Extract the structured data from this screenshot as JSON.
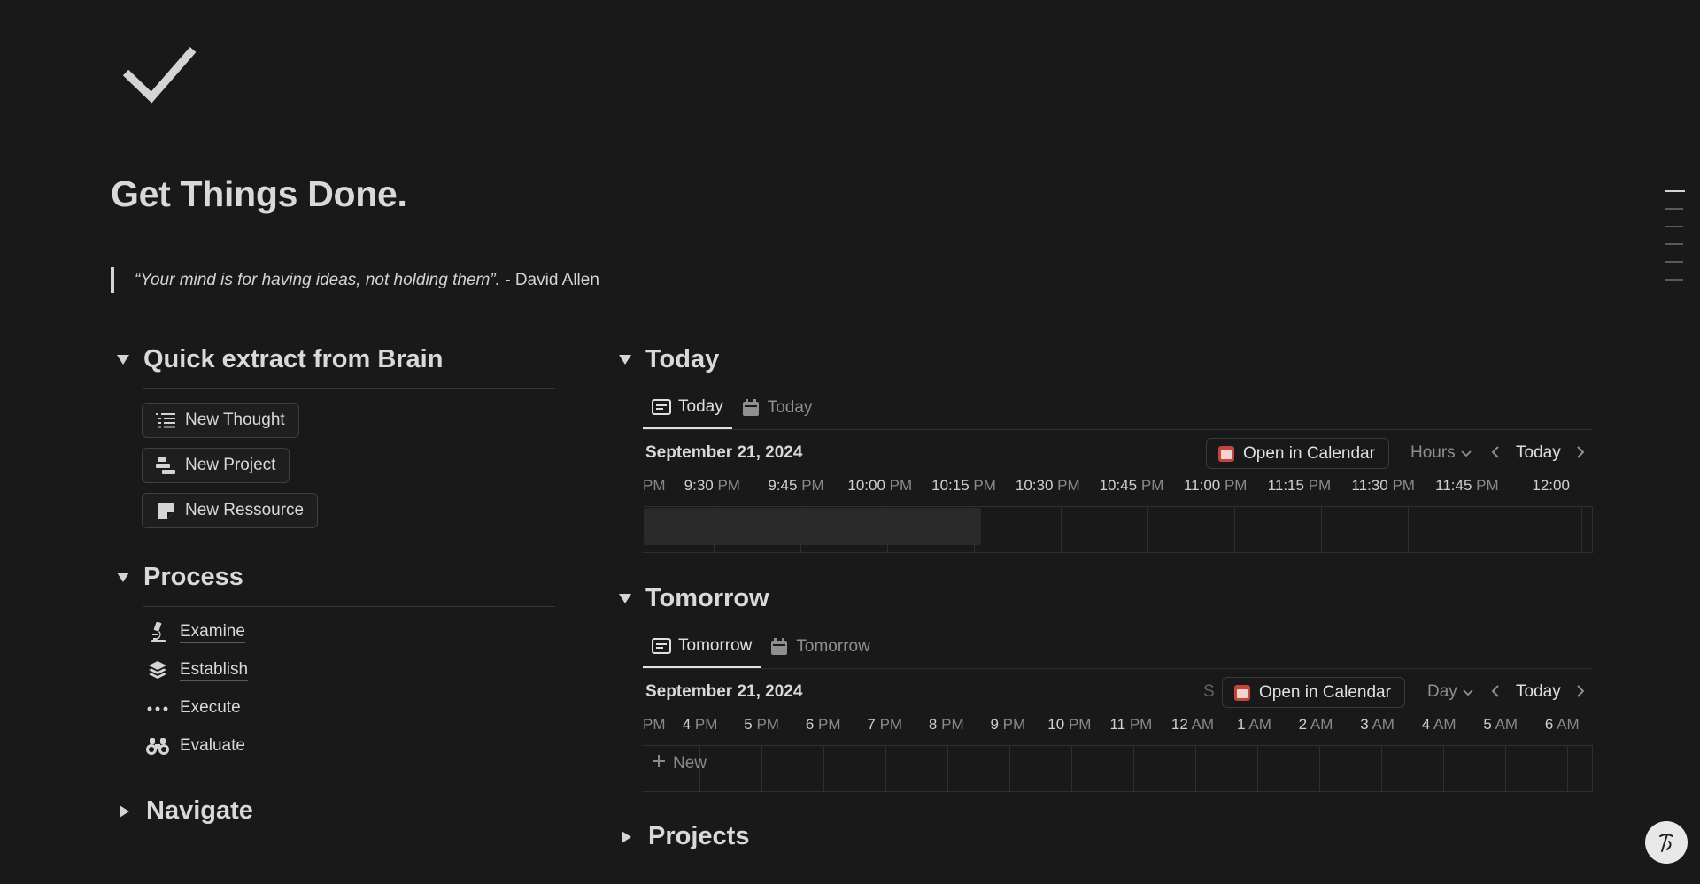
{
  "page": {
    "icon": "checkmark-icon",
    "title": "Get Things Done.",
    "quote_italic": "“Your mind is for having ideas, not holding them”.",
    "quote_author": " - David Allen"
  },
  "quick_extract": {
    "heading": "Quick extract from  Brain",
    "buttons": [
      {
        "label": "New Thought",
        "icon": "list-icon"
      },
      {
        "label": "New Project",
        "icon": "timeline-bars-icon"
      },
      {
        "label": "New Ressource",
        "icon": "note-icon"
      }
    ]
  },
  "process": {
    "heading": "Process",
    "items": [
      {
        "label": "Examine",
        "icon": "microscope-icon"
      },
      {
        "label": "Establish",
        "icon": "layers-icon"
      },
      {
        "label": "Execute",
        "icon": "ellipsis-icon"
      },
      {
        "label": "Evaluate",
        "icon": "binoculars-icon"
      }
    ]
  },
  "navigate": {
    "heading": "Navigate"
  },
  "today": {
    "heading": "Today",
    "tabs": [
      {
        "label": "Today",
        "icon": "list-view-icon",
        "active": true
      },
      {
        "label": "Today",
        "icon": "calendar-view-icon",
        "active": false
      }
    ],
    "date": "September 21, 2024",
    "open_calendar": "Open in Calendar",
    "view_select": "Hours",
    "today_button": "Today",
    "time_labels": [
      {
        "t": "",
        "p": "PM"
      },
      {
        "t": "9:30",
        "p": "PM"
      },
      {
        "t": "9:45",
        "p": "PM"
      },
      {
        "t": "10:00",
        "p": "PM"
      },
      {
        "t": "10:15",
        "p": "PM"
      },
      {
        "t": "10:30",
        "p": "PM"
      },
      {
        "t": "10:45",
        "p": "PM"
      },
      {
        "t": "11:00",
        "p": "PM"
      },
      {
        "t": "11:15",
        "p": "PM"
      },
      {
        "t": "11:30",
        "p": "PM"
      },
      {
        "t": "11:45",
        "p": "PM"
      },
      {
        "t": "12:00",
        "p": ""
      }
    ]
  },
  "tomorrow": {
    "heading": "Tomorrow",
    "tabs": [
      {
        "label": "Tomorrow",
        "icon": "list-view-icon",
        "active": true
      },
      {
        "label": "Tomorrow",
        "icon": "calendar-view-icon",
        "active": false
      }
    ],
    "date": "September 21, 2024",
    "partial_letter": "S",
    "open_calendar": "Open in Calendar",
    "view_select": "Day",
    "today_button": "Today",
    "new_label": "New",
    "time_labels": [
      {
        "t": "",
        "p": "PM"
      },
      {
        "t": "4",
        "p": "PM"
      },
      {
        "t": "5",
        "p": "PM"
      },
      {
        "t": "6",
        "p": "PM"
      },
      {
        "t": "7",
        "p": "PM"
      },
      {
        "t": "8",
        "p": "PM"
      },
      {
        "t": "9",
        "p": "PM"
      },
      {
        "t": "10",
        "p": "PM"
      },
      {
        "t": "11",
        "p": "PM"
      },
      {
        "t": "12",
        "p": "AM"
      },
      {
        "t": "1",
        "p": "AM"
      },
      {
        "t": "2",
        "p": "AM"
      },
      {
        "t": "3",
        "p": "AM"
      },
      {
        "t": "4",
        "p": "AM"
      },
      {
        "t": "5",
        "p": "AM"
      },
      {
        "t": "6",
        "p": "AM"
      }
    ]
  },
  "projects": {
    "heading": "Projects"
  },
  "colors": {
    "background": "#191919",
    "text": "#d4d4d4",
    "calendar_red": "#c2453e"
  }
}
